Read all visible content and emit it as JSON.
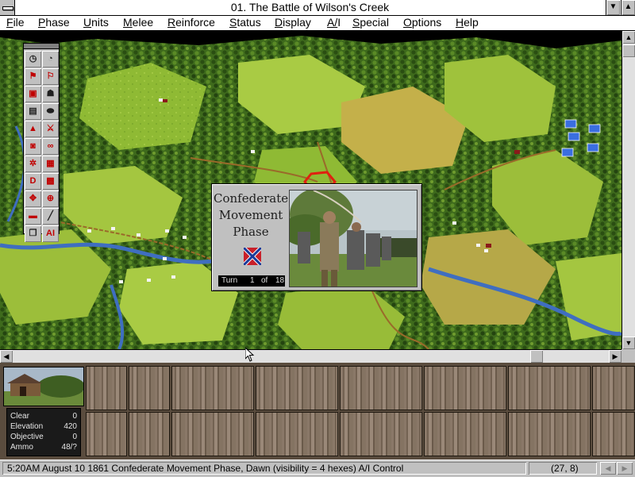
{
  "window": {
    "title": "01. The Battle of Wilson's Creek",
    "minimize_glyph": "▼",
    "maximize_glyph": "▲"
  },
  "menu": [
    "File",
    "Phase",
    "Units",
    "Melee",
    "Reinforce",
    "Status",
    "Display",
    "A/I",
    "Special",
    "Options",
    "Help"
  ],
  "toolbar": {
    "buttons": [
      {
        "name": "turn-clock-icon",
        "glyph": "◷"
      },
      {
        "name": "timer-icon",
        "glyph": "◔"
      },
      {
        "name": "flag-up-icon",
        "glyph": "⚑"
      },
      {
        "name": "flag-down-icon",
        "glyph": "⚐"
      },
      {
        "name": "unit-stack-icon",
        "glyph": "▣"
      },
      {
        "name": "soldier-icon",
        "glyph": "☗"
      },
      {
        "name": "document-icon",
        "glyph": "▤"
      },
      {
        "name": "cannon-ball-icon",
        "glyph": "⬬"
      },
      {
        "name": "pyramid-icon",
        "glyph": "▲"
      },
      {
        "name": "artillery-icon",
        "glyph": "⚔"
      },
      {
        "name": "helmet-icon",
        "glyph": "◙"
      },
      {
        "name": "binoculars-icon",
        "glyph": "∞"
      },
      {
        "name": "wheel-icon",
        "glyph": "✲"
      },
      {
        "name": "screen-icon",
        "glyph": "▦"
      },
      {
        "name": "defend-icon",
        "glyph": "D"
      },
      {
        "name": "grid-icon",
        "glyph": "▩"
      },
      {
        "name": "move-arrows-icon",
        "glyph": "✥"
      },
      {
        "name": "target-icon",
        "glyph": "⊕"
      },
      {
        "name": "usa-flag-icon",
        "glyph": "▬"
      },
      {
        "name": "line-draw-icon",
        "glyph": "╱"
      },
      {
        "name": "layers-icon",
        "glyph": "❐"
      },
      {
        "name": "ai-icon",
        "glyph": "AI"
      }
    ]
  },
  "phase_dialog": {
    "title_line1": "Confederate",
    "title_line2": "Movement",
    "title_line3": "Phase",
    "turn_label": "Turn",
    "turn_current": "1",
    "turn_of": "of",
    "turn_total": "18"
  },
  "terrain_info": {
    "rows": [
      {
        "label": "Clear",
        "value": "0"
      },
      {
        "label": "Elevation",
        "value": "420"
      },
      {
        "label": "Objective",
        "value": "0"
      },
      {
        "label": "Ammo",
        "value": "48/?"
      }
    ]
  },
  "status": {
    "text": "5:20AM August 10 1861 Confederate Movement Phase, Dawn (visibility = 4 hexes) A/I Control",
    "coords": "(27, 8)",
    "left_arrow": "◀",
    "right_arrow": "▶"
  },
  "colors": {
    "confederate_red": "#c8202a",
    "union_blue": "#3a6ee0",
    "grass_light": "#9ec23a",
    "grass_dark": "#4f7a22",
    "river": "#3f6ec0",
    "road": "#9a6a2a"
  }
}
